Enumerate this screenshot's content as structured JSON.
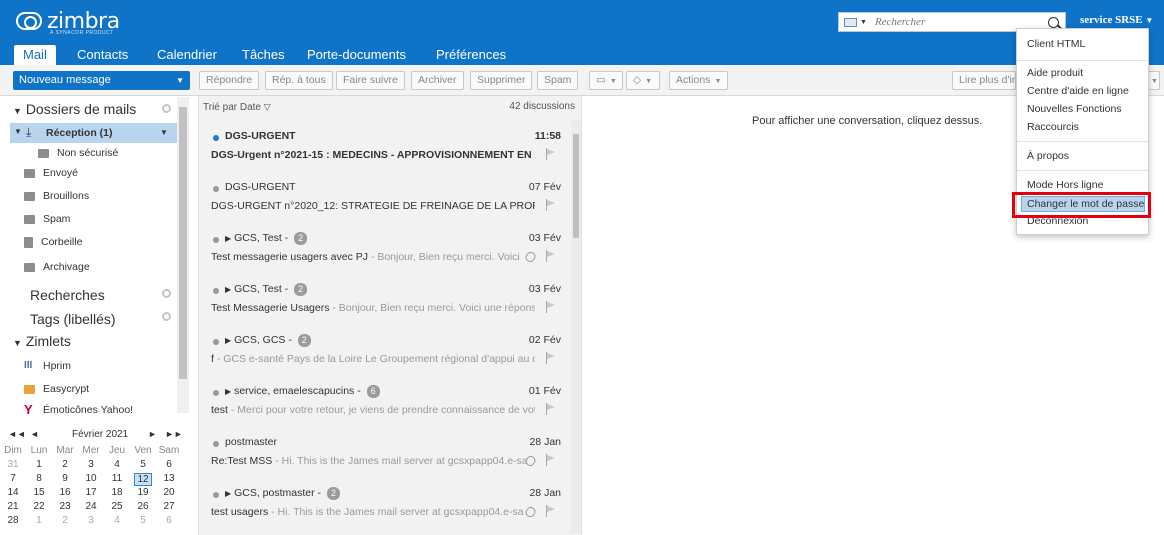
{
  "brand": {
    "name": "zimbra",
    "tagline": "A SYNACOR PRODUCT"
  },
  "header": {
    "search_placeholder": "Rechercher",
    "user": "service SRSE"
  },
  "tabs": [
    "Mail",
    "Contacts",
    "Calendrier",
    "Tâches",
    "Porte-documents",
    "Préférences"
  ],
  "toolbar": {
    "new_message": "Nouveau message",
    "reply": "Répondre",
    "reply_all": "Rép. à tous",
    "forward": "Faire suivre",
    "archive": "Archiver",
    "delete": "Supprimer",
    "spam": "Spam",
    "actions": "Actions",
    "read_more": "Lire plus d'in"
  },
  "sidebar": {
    "mail_folders": "Dossiers de mails",
    "inbox": "Réception (1)",
    "folders": [
      "Non sécurisé",
      "Envoyé",
      "Brouillons",
      "Spam",
      "Corbeille",
      "Archivage"
    ],
    "searches": "Recherches",
    "tags": "Tags (libellés)",
    "zimlets": "Zimlets",
    "zimlet_items": [
      "Hprim",
      "Easycrypt",
      "Émoticônes Yahoo!"
    ]
  },
  "calendar": {
    "month": "Février 2021",
    "weekdays": [
      "Dim",
      "Lun",
      "Mar",
      "Mer",
      "Jeu",
      "Ven",
      "Sam"
    ],
    "weeks": [
      [
        "31",
        "1",
        "2",
        "3",
        "4",
        "5",
        "6"
      ],
      [
        "7",
        "8",
        "9",
        "10",
        "11",
        "12",
        "13"
      ],
      [
        "14",
        "15",
        "16",
        "17",
        "18",
        "19",
        "20"
      ],
      [
        "21",
        "22",
        "23",
        "24",
        "25",
        "26",
        "27"
      ],
      [
        "28",
        "1",
        "2",
        "3",
        "4",
        "5",
        "6"
      ]
    ],
    "today": "12"
  },
  "list": {
    "sort": "Trié par Date",
    "count": "42 discussions",
    "messages": [
      {
        "from": "DGS-URGENT",
        "date": "11:58",
        "subject": "DGS-Urgent n°2021-15 : MEDECINS - APPROVISIONNEMENT EN F",
        "fragment": "",
        "unread": true,
        "thread": false,
        "badge": "",
        "attach": false
      },
      {
        "from": "DGS-URGENT",
        "date": "07 Fév",
        "subject": "DGS-URGENT n°2020_12: STRATEGIE DE FREINAGE DE LA PROPAGATIC",
        "fragment": "",
        "unread": false,
        "thread": false,
        "badge": "",
        "attach": false
      },
      {
        "from": "GCS, Test",
        "date": "03 Fév",
        "subject": "Test messagerie usagers avec PJ",
        "fragment": " - Bonjour, Bien reçu merci. Voici",
        "unread": false,
        "thread": true,
        "badge": "2",
        "attach": true
      },
      {
        "from": "GCS, Test",
        "date": "03 Fév",
        "subject": "Test Messagerie Usagers",
        "fragment": " - Bonjour, Bien reçu merci. Voici une réponse",
        "unread": false,
        "thread": true,
        "badge": "2",
        "attach": false
      },
      {
        "from": "GCS, GCS",
        "date": "02 Fév",
        "subject": "f",
        "fragment": " - GCS e-santé Pays de la Loire Le Groupement régional d'appui au dé",
        "unread": false,
        "thread": true,
        "badge": "2",
        "attach": false
      },
      {
        "from": "service, emaelescapucins",
        "date": "01 Fév",
        "subject": "test",
        "fragment": " - Merci pour votre retour, je viens de prendre connaissance de vot",
        "unread": false,
        "thread": true,
        "badge": "6",
        "attach": false
      },
      {
        "from": "postmaster",
        "date": "28 Jan",
        "subject": "Re:Test MSS",
        "fragment": " - Hi. This is the James mail server at gcsxpapp04.e-sa",
        "unread": false,
        "thread": false,
        "badge": "",
        "attach": true
      },
      {
        "from": "GCS, postmaster",
        "date": "28 Jan",
        "subject": "test usagers",
        "fragment": " - Hi. This is the James mail server at gcsxpapp04.e-sa",
        "unread": false,
        "thread": true,
        "badge": "2",
        "attach": true
      }
    ]
  },
  "reading": {
    "empty": "Pour afficher une conversation, cliquez dessus."
  },
  "user_menu": {
    "items": [
      "Client HTML",
      "Aide produit",
      "Centre d'aide en ligne",
      "Nouvelles Fonctions",
      "Raccourcis",
      "À propos",
      "Mode Hors ligne",
      "Changer le mot de passe",
      "Déconnexion"
    ]
  },
  "colors": {
    "brand": "#0f73c8",
    "highlight": "#e00010",
    "selection": "#b9d4ef"
  }
}
